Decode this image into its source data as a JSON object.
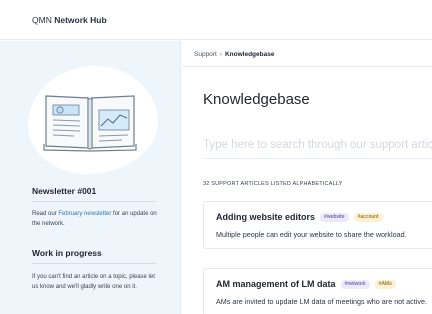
{
  "header": {
    "brand_prefix": "QMN",
    "brand_name": "Network Hub"
  },
  "sidebar": {
    "newsletter": {
      "title": "Newsletter #001",
      "text_before": "Read our ",
      "link": "February newsletter",
      "text_after": " for an update on the network."
    },
    "wip": {
      "title": "Work in progress",
      "text": "If you can't find an article on a topic, please let us know and we'll gladly write one on it."
    }
  },
  "breadcrumb": {
    "parent": "Support",
    "separator": "›",
    "current": "Knowledgebase"
  },
  "main": {
    "title": "Knowledgebase",
    "search_placeholder": "Type here to search through our support articles",
    "count": "32 SUPPORT ARTICLES LISTED ALPHABETICALLY"
  },
  "articles": [
    {
      "title": "Adding website editors",
      "tags": [
        "#website",
        "#account"
      ],
      "description": "Multiple people can edit your website to share the workload."
    },
    {
      "title": "AM management of LM data",
      "tags": [
        "#network",
        "#AMs"
      ],
      "description": "AMs are invited to update LM data of meetings who are not active."
    }
  ],
  "colors": {
    "sidebar_bg": "#eef5fb",
    "link": "#2a78c6",
    "tag_purple": "#ebe9fb",
    "tag_yellow": "#fdf1cf"
  },
  "icons": [
    "book-illustration"
  ]
}
